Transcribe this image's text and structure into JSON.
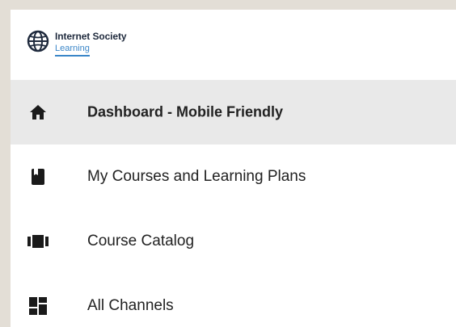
{
  "brand": {
    "name": "Internet Society",
    "sub": "Learning",
    "logo_icon": "globe-icon",
    "accent_color": "#3a86c8"
  },
  "nav": {
    "items": [
      {
        "label": "Dashboard - Mobile Friendly",
        "icon": "home-icon",
        "active": true
      },
      {
        "label": "My Courses and Learning Plans",
        "icon": "book-icon",
        "active": false
      },
      {
        "label": "Course Catalog",
        "icon": "catalog-icon",
        "active": false
      },
      {
        "label": "All Channels",
        "icon": "dashboard-grid-icon",
        "active": false
      }
    ]
  },
  "colors": {
    "background": "#e3ded6",
    "panel": "#ffffff",
    "active_row": "#e9e9e9",
    "icon": "#1a1a1a",
    "text": "#222222"
  }
}
